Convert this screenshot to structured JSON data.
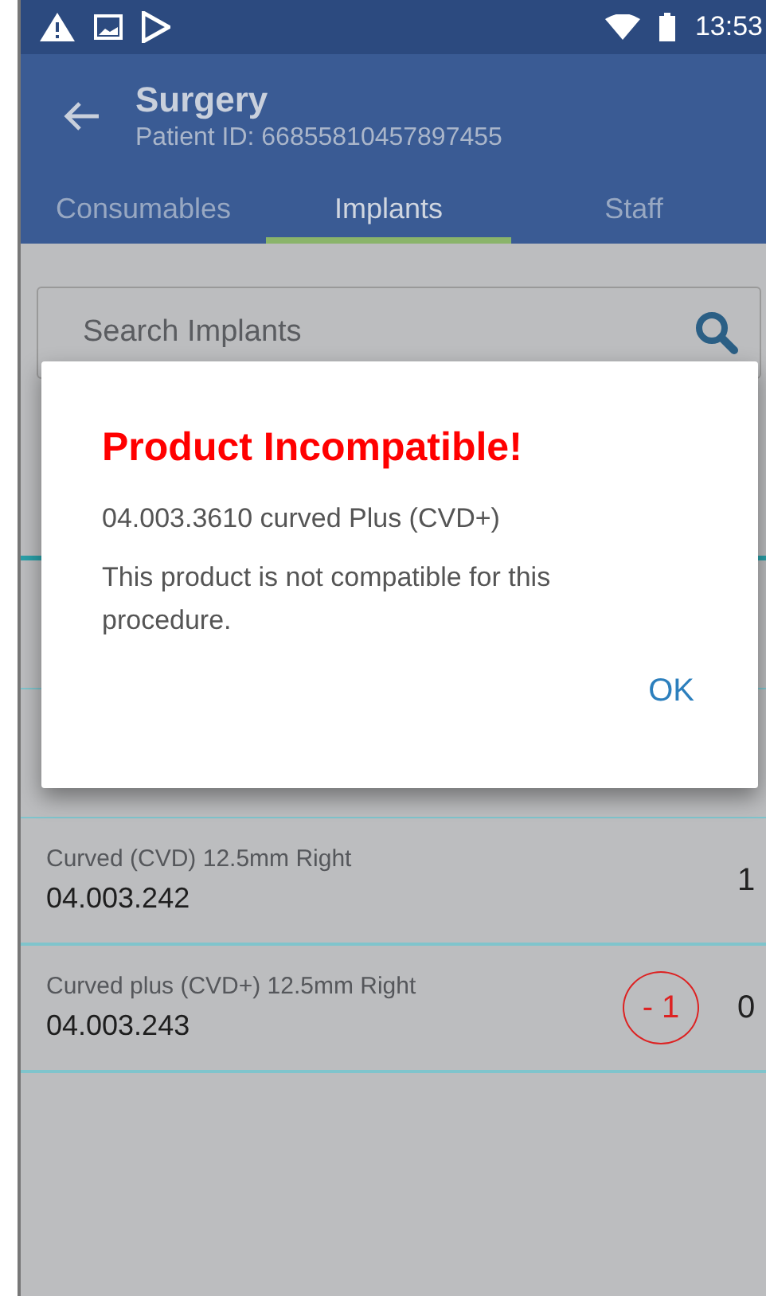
{
  "status_bar": {
    "time": "13:53"
  },
  "app_bar": {
    "title": "Surgery",
    "subtitle": "Patient ID: 66855810457897455"
  },
  "tabs": [
    {
      "label": "Consumables",
      "selected": false
    },
    {
      "label": "Implants",
      "selected": true
    },
    {
      "label": "Staff",
      "selected": false
    }
  ],
  "search": {
    "placeholder": "Search Implants"
  },
  "rows": [
    {
      "name": "Curved (CVD) 12.5mm Right",
      "code": "04.003.242",
      "quantity": "1"
    },
    {
      "name": "Curved plus (CVD+) 12.5mm Right",
      "code": "04.003.243",
      "quantity": "0",
      "badge": "- 1"
    }
  ],
  "dialog": {
    "title": "Product Incompatible!",
    "product": "04.003.3610 curved Plus (CVD+)",
    "message": "This product is not compatible for this procedure.",
    "button": "OK"
  }
}
